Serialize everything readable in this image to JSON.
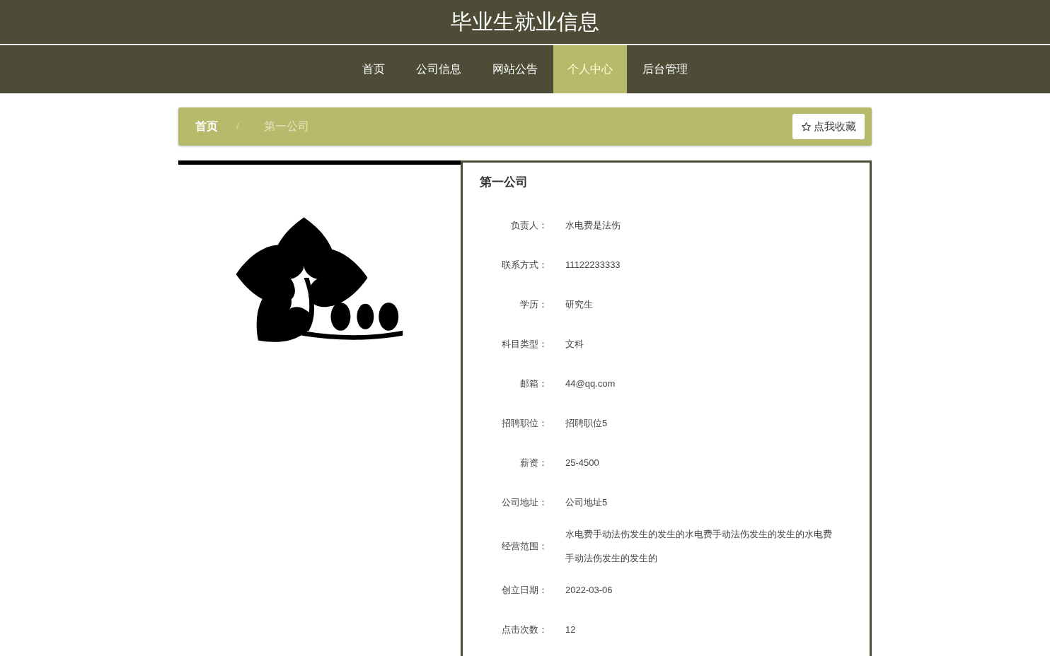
{
  "site_title": "毕业生就业信息",
  "nav": [
    {
      "label": "首页",
      "selected": false
    },
    {
      "label": "公司信息",
      "selected": false
    },
    {
      "label": "网站公告",
      "selected": false
    },
    {
      "label": "个人中心",
      "selected": true
    },
    {
      "label": "后台管理",
      "selected": false
    }
  ],
  "breadcrumb": [
    {
      "label": "首页",
      "selected": false
    },
    {
      "label": "第一公司",
      "selected": true
    }
  ],
  "breadcrumb_separator": "/",
  "favorite_button": {
    "label": "点我收藏"
  },
  "detail": {
    "title": "第一公司",
    "fields": [
      {
        "label": "负责人：",
        "value": "水电费是法伤"
      },
      {
        "label": "联系方式：",
        "value": "11122233333"
      },
      {
        "label": "学历：",
        "value": "研究生"
      },
      {
        "label": "科目类型：",
        "value": "文科"
      },
      {
        "label": "邮箱：",
        "value": "44@qq.com"
      },
      {
        "label": "招聘职位：",
        "value": "招聘职位5"
      },
      {
        "label": "薪资：",
        "value": "25-4500"
      },
      {
        "label": "公司地址：",
        "value": "公司地址5"
      },
      {
        "label": "经营范围：",
        "value": "水电费手动法伤发生的发生的水电费手动法伤发生的发生的水电费手动法伤发生的发生的"
      },
      {
        "label": "创立日期：",
        "value": "2022-03-06"
      },
      {
        "label": "点击次数：",
        "value": "12"
      }
    ]
  }
}
